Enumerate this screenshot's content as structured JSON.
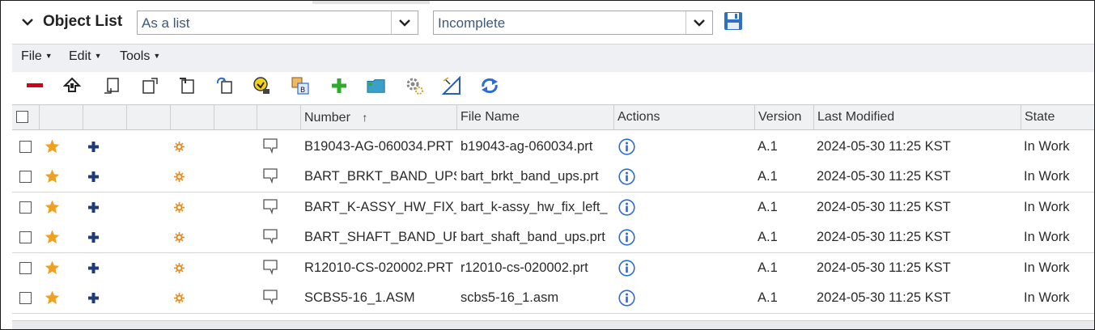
{
  "header": {
    "title": "Object List",
    "view_select": "As a list",
    "filter_select": "Incomplete"
  },
  "menus": [
    {
      "label": "File"
    },
    {
      "label": "Edit"
    },
    {
      "label": "Tools"
    }
  ],
  "toolbar": [
    {
      "icon": "remove-icon",
      "color": "#d0021b"
    },
    {
      "icon": "upload-icon"
    },
    {
      "icon": "paste-icon"
    },
    {
      "icon": "copy-icon"
    },
    {
      "icon": "cut-icon"
    },
    {
      "icon": "refresh-doc-icon"
    },
    {
      "icon": "checkout-icon"
    },
    {
      "icon": "rename-icon"
    },
    {
      "icon": "add-icon",
      "color": "#2eaa2e"
    },
    {
      "icon": "folder-icon"
    },
    {
      "icon": "settings-icon"
    },
    {
      "icon": "measure-icon"
    },
    {
      "icon": "sync-icon",
      "color": "#2b6cd8"
    }
  ],
  "columns": {
    "number": "Number",
    "sort_indicator": "↑",
    "file_name": "File Name",
    "actions": "Actions",
    "version": "Version",
    "last_modified": "Last Modified",
    "state": "State"
  },
  "rows": [
    {
      "number": "B19043-AG-060034.PRT",
      "file_name": "b19043-ag-060034.prt",
      "version": "A.1",
      "last_modified": "2024-05-30 11:25 KST",
      "state": "In Work"
    },
    {
      "number": "BART_BRKT_BAND_UPS.PRT",
      "file_name": "bart_brkt_band_ups.prt",
      "version": "A.1",
      "last_modified": "2024-05-30 11:25 KST",
      "state": "In Work"
    },
    {
      "number": "BART_K-ASSY_HW_FIX_LEFT.PRT",
      "file_name": "bart_k-assy_hw_fix_left_",
      "version": "A.1",
      "last_modified": "2024-05-30 11:25 KST",
      "state": "In Work"
    },
    {
      "number": "BART_SHAFT_BAND_UPS.PRT",
      "file_name": "bart_shaft_band_ups.prt",
      "version": "A.1",
      "last_modified": "2024-05-30 11:25 KST",
      "state": "In Work"
    },
    {
      "number": "R12010-CS-020002.PRT",
      "file_name": "r12010-cs-020002.prt",
      "version": "A.1",
      "last_modified": "2024-05-30 11:25 KST",
      "state": "In Work"
    },
    {
      "number": "SCBS5-16_1.ASM",
      "file_name": "scbs5-16_1.asm",
      "version": "A.1",
      "last_modified": "2024-05-30 11:25 KST",
      "state": "In Work"
    }
  ],
  "colors": {
    "star": "#f0a020",
    "plus": "#1e3a78",
    "status": "#e88a1a",
    "info": "#2b6cd8"
  }
}
